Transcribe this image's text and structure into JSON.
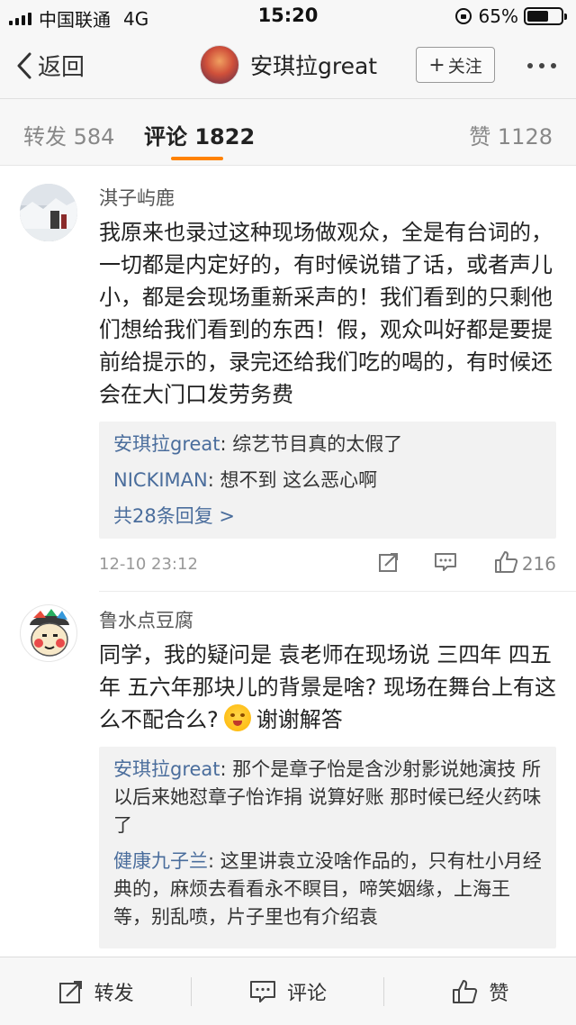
{
  "status_bar": {
    "carrier": "中国联通",
    "network": "4G",
    "time": "15:20",
    "battery": "65%",
    "battery_level": 0.65
  },
  "nav": {
    "back_label": "返回",
    "title": "安琪拉great",
    "follow_label": "关注"
  },
  "tabs": {
    "repost": "转发 584",
    "comments": "评论 1822",
    "likes": "赞 1128",
    "accent_color": "#ff8200"
  },
  "comments": [
    {
      "username": "淇子屿鹿",
      "text": "我原来也录过这种现场做观众，全是有台词的，一切都是内定好的，有时候说错了话，或者声儿小，都是会现场重新采声的！我们看到的只剩他们想给我们看到的东西！假，观众叫好都是要提前给提示的，录完还给我们吃的喝的，有时候还会在大门口发劳务费",
      "replies": [
        {
          "name": "安琪拉great",
          "text": ": 综艺节目真的太假了"
        },
        {
          "name": "NICKIMAN",
          "text": ": 想不到 这么恶心啊"
        }
      ],
      "more_replies": "共28条回复 >",
      "time": "12-10 23:12",
      "likes": "216"
    },
    {
      "username": "鲁水点豆腐",
      "text_before_emoji": "同学，我的疑问是 袁老师在现场说 三四年 四五年 五六年那块儿的背景是啥? 现场在舞台上有这么不配合么?",
      "text_after_emoji": "谢谢解答",
      "replies": [
        {
          "name": "安琪拉great",
          "text": ": 那个是章子怡是含沙射影说她演技 所以后来她怼章子怡诈捐  说算好账 那时候已经火药味了"
        },
        {
          "name": "健康九子兰",
          "text": ": 这里讲袁立没啥作品的，只有杜小月经典的，麻烦去看看永不瞑目，啼笑姻缘，上海王等，别乱喷，片子里也有介绍袁"
        }
      ]
    }
  ],
  "bottom_bar": {
    "repost": "转发",
    "comment": "评论",
    "like": "赞"
  },
  "colors": {
    "link_blue": "#4a6d9c",
    "reply_bg": "#f2f2f2"
  }
}
